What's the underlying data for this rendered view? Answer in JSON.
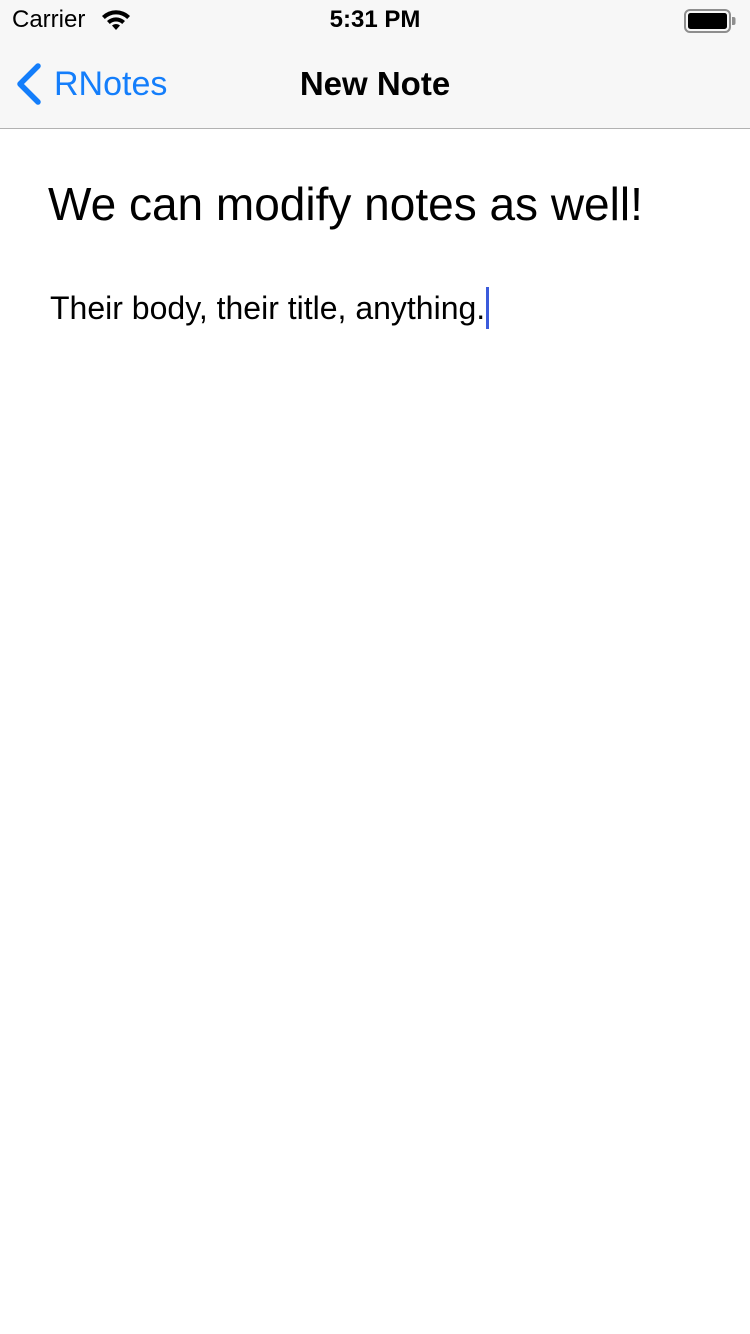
{
  "status_bar": {
    "carrier": "Carrier",
    "time": "5:31 PM",
    "wifi_icon": "wifi-icon",
    "battery_icon": "battery-icon"
  },
  "nav": {
    "back_label": "RNotes",
    "back_icon": "chevron-left-icon",
    "title": "New Note",
    "accent_color": "#147efb"
  },
  "note": {
    "title": "We can modify notes as well!",
    "body": "Their body, their title, anything."
  },
  "colors": {
    "bar_background": "#f7f7f7",
    "caret": "#3b5bdb"
  }
}
